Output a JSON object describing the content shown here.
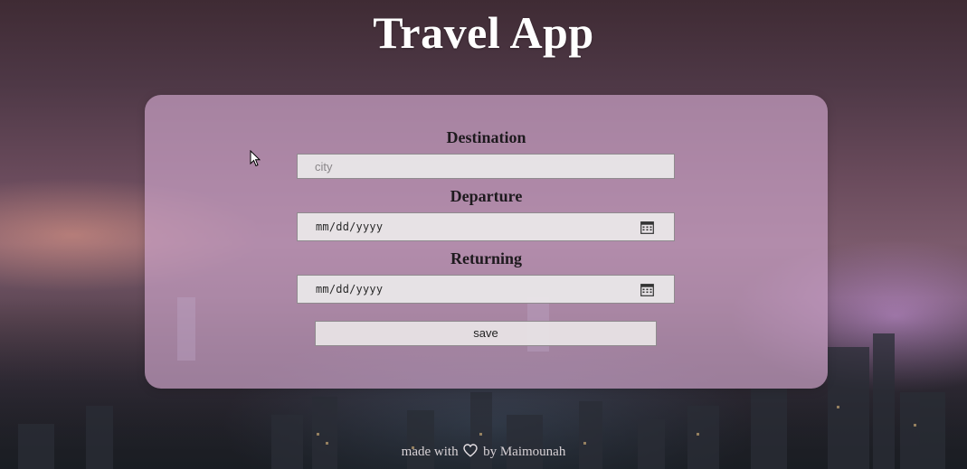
{
  "app": {
    "title": "Travel App"
  },
  "form": {
    "destination_label": "Destination",
    "destination_placeholder": "city",
    "destination_value": "",
    "departure_label": "Departure",
    "departure_value": "mm/dd/yyyy",
    "returning_label": "Returning",
    "returning_value": "mm/dd/yyyy",
    "save_label": "save"
  },
  "footer": {
    "prefix": "made with",
    "suffix": "by Maimounah",
    "icon": "heart-outline-icon"
  },
  "icons": {
    "date_picker": "calendar-icon",
    "pointer": "mouse-cursor-icon"
  },
  "colors": {
    "card_background": "#c8a0c3",
    "title_text": "#ffffff",
    "label_text": "#1e1a1e",
    "field_background": "#ebe8e9"
  }
}
